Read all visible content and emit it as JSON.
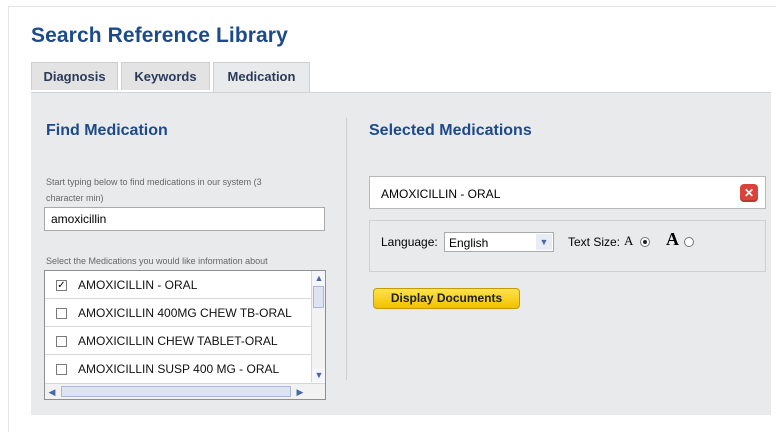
{
  "page": {
    "title": "Search Reference Library"
  },
  "tabs": [
    {
      "label": "Diagnosis",
      "active": false
    },
    {
      "label": "Keywords",
      "active": false
    },
    {
      "label": "Medication",
      "active": true
    }
  ],
  "find": {
    "heading": "Find Medication",
    "instruction_line1": "Start typing below to find medications in our system (3",
    "instruction_line2": "character min)",
    "input_value": "amoxicillin",
    "list_instruction": "Select the Medications you would like information about",
    "results": [
      {
        "label": "AMOXICILLIN - ORAL",
        "checked": true
      },
      {
        "label": "AMOXICILLIN 400MG CHEW TB-ORAL",
        "checked": false
      },
      {
        "label": "AMOXICILLIN CHEW TABLET-ORAL",
        "checked": false
      },
      {
        "label": "AMOXICILLIN SUSP 400 MG - ORAL",
        "checked": false
      }
    ]
  },
  "selected": {
    "heading": "Selected Medications",
    "items": [
      {
        "label": "AMOXICILLIN - ORAL"
      }
    ],
    "language_label": "Language:",
    "language_value": "English",
    "text_size_label": "Text Size:",
    "size_small_glyph": "A",
    "size_large_glyph": "A",
    "text_size_selected": "small",
    "display_button": "Display Documents"
  },
  "colors": {
    "heading_blue": "#1d4a8b",
    "panel_bg": "#e9eaec",
    "button_yellow": "#f7d21f",
    "remove_red": "#d9433b"
  },
  "icons": {
    "remove": "close-icon",
    "dropdown": "chevron-down-icon",
    "scroll_up": "chevron-up-icon",
    "scroll_down": "chevron-down-icon",
    "scroll_left": "chevron-left-icon",
    "scroll_right": "chevron-right-icon",
    "checkmark": "checkmark-icon"
  }
}
